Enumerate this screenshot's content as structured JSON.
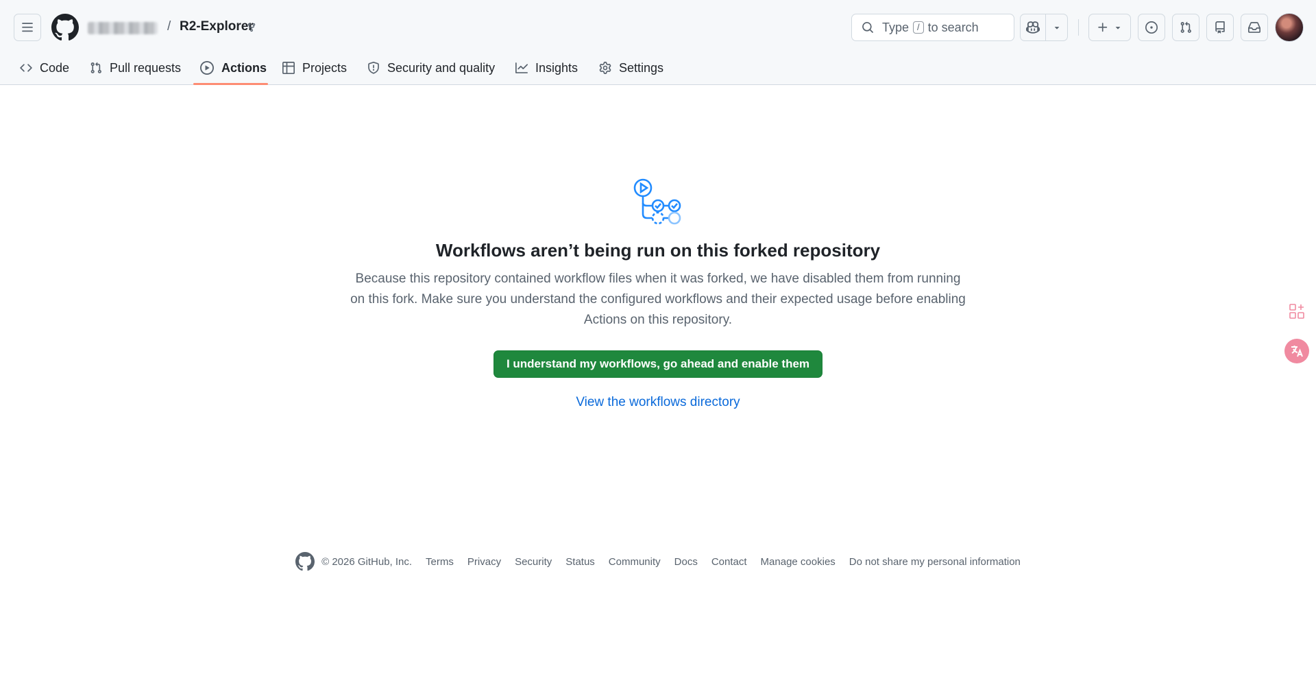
{
  "header": {
    "repo_separator": "/",
    "repo_name": "R2-Explorer",
    "search": {
      "prefix": "Type",
      "key": "/",
      "suffix": "to search"
    }
  },
  "nav": {
    "tabs": [
      {
        "label": "Code",
        "icon": "code-icon"
      },
      {
        "label": "Pull requests",
        "icon": "git-pull-request-icon"
      },
      {
        "label": "Actions",
        "icon": "play-icon",
        "active": true
      },
      {
        "label": "Projects",
        "icon": "table-icon"
      },
      {
        "label": "Security and quality",
        "icon": "shield-icon"
      },
      {
        "label": "Insights",
        "icon": "graph-icon"
      },
      {
        "label": "Settings",
        "icon": "gear-icon"
      }
    ]
  },
  "main": {
    "title": "Workflows aren’t being run on this forked repository",
    "description": "Because this repository contained workflow files when it was forked, we have disabled them from running on this fork. Make sure you understand the configured workflows and their expected usage before enabling Actions on this repository.",
    "enable_button": "I understand my workflows, go ahead and enable them",
    "directory_link": "View the workflows directory"
  },
  "footer": {
    "copyright": "© 2026 GitHub, Inc.",
    "links": [
      "Terms",
      "Privacy",
      "Security",
      "Status",
      "Community",
      "Docs",
      "Contact",
      "Manage cookies",
      "Do not share my personal information"
    ]
  },
  "colors": {
    "accent_underline": "#fd8c73",
    "primary_button": "#1f883d",
    "link": "#0969da",
    "workflow_icon": "#218bff"
  }
}
